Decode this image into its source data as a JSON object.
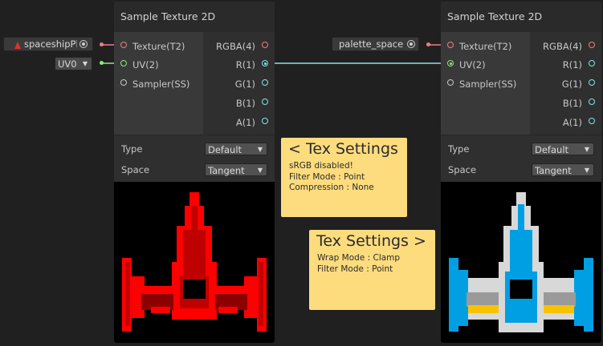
{
  "colors": {
    "background": "#202020",
    "node": "#393939",
    "texture_port": "#ef7c8a",
    "vector2_port": "#8eea7a",
    "vector1_port": "#84e4e7",
    "sticky": "#fddc7e"
  },
  "left_node": {
    "title": "Sample Texture 2D",
    "inputs": [
      "Texture(T2)",
      "UV(2)",
      "Sampler(SS)"
    ],
    "outputs": [
      "RGBA(4)",
      "R(1)",
      "G(1)",
      "B(1)",
      "A(1)"
    ],
    "type_label": "Type",
    "type_value": "Default",
    "space_label": "Space",
    "space_value": "Tangent",
    "texture_field": "spaceshipPl",
    "uv_field": "UV0"
  },
  "right_node": {
    "title": "Sample Texture 2D",
    "inputs": [
      "Texture(T2)",
      "UV(2)",
      "Sampler(SS)"
    ],
    "outputs": [
      "RGBA(4)",
      "R(1)",
      "G(1)",
      "B(1)",
      "A(1)"
    ],
    "type_label": "Type",
    "type_value": "Default",
    "space_label": "Space",
    "space_value": "Tangent",
    "texture_field": "palette_space"
  },
  "sticky_left": {
    "title": "< Tex Settings",
    "lines": [
      "sRGB disabled!",
      "Filter Mode : Point",
      "Compression : None"
    ]
  },
  "sticky_right": {
    "title": "Tex Settings >",
    "lines": [
      "Wrap Mode : Clamp",
      "Filter Mode : Point"
    ]
  },
  "icons": [
    "texture-icon",
    "target-icon",
    "chevron-down-icon"
  ]
}
